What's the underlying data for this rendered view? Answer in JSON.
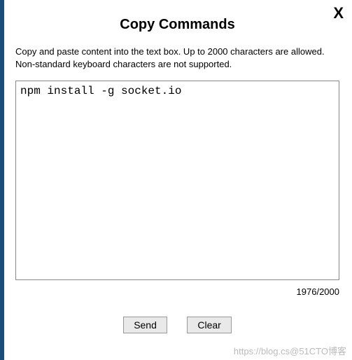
{
  "dialog": {
    "title": "Copy Commands",
    "close_label": "X",
    "instructions": "Copy and paste content into the text box. Up to 2000 characters are allowed. Non-standard keyboard characters are not supported.",
    "textbox_value": "npm install -g socket.io",
    "counter": "1976/2000",
    "send_label": "Send",
    "clear_label": "Clear"
  },
  "watermark": "https://blog.cs@51CTO博客"
}
